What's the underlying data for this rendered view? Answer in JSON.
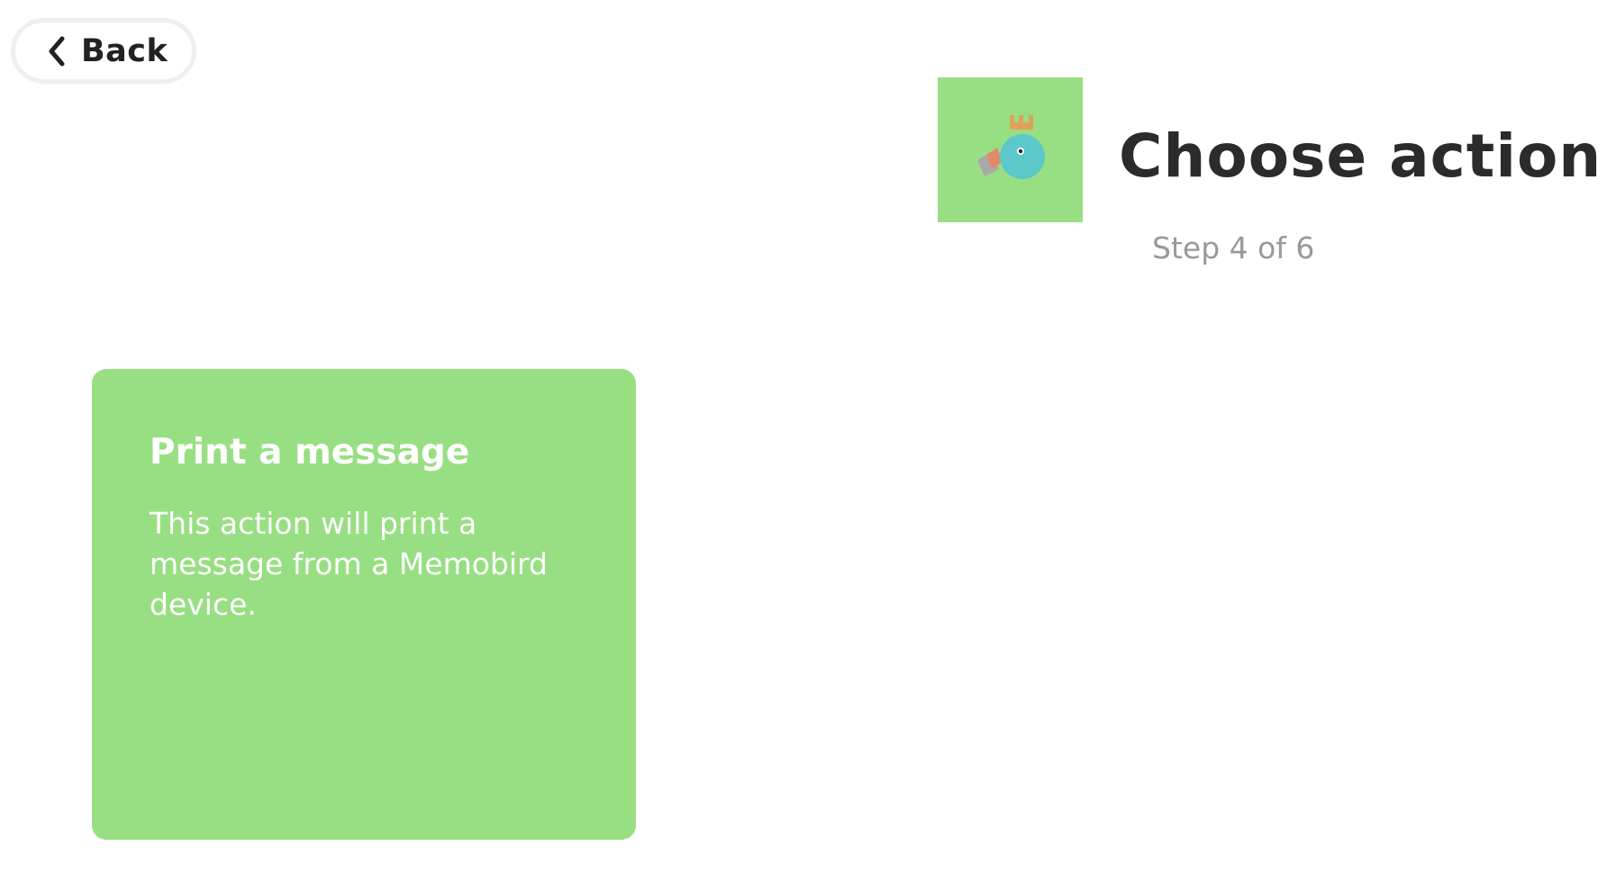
{
  "header": {
    "back_label": "Back",
    "title": "Choose action",
    "step": "Step 4 of 6",
    "service_logo_icon": "memobird-bird-icon",
    "service_color": "#98df83"
  },
  "actions": [
    {
      "title": "Print a message",
      "description": "This action will print a message from a Memobird device."
    }
  ]
}
